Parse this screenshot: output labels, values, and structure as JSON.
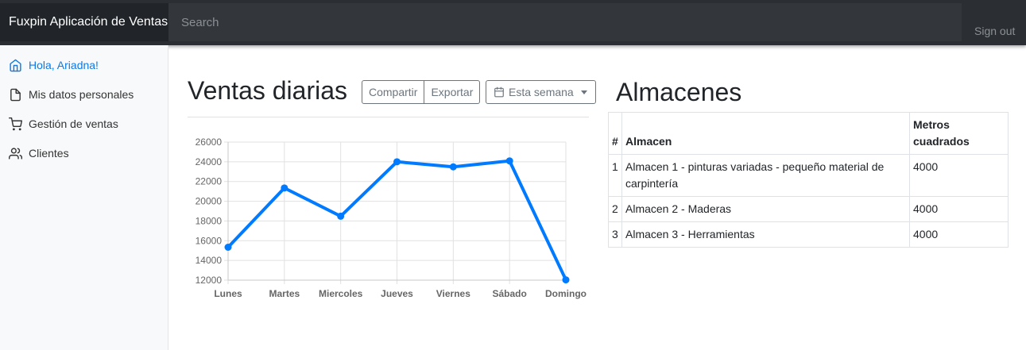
{
  "navbar": {
    "brand": "Fuxpin Aplicación de Ventas",
    "search_placeholder": "Search",
    "signout": "Sign out"
  },
  "sidebar": {
    "items": [
      {
        "label": "Hola, Ariadna!",
        "icon": "home-icon",
        "active": true
      },
      {
        "label": "Mis datos personales",
        "icon": "file-icon",
        "active": false
      },
      {
        "label": "Gestión de ventas",
        "icon": "shopping-cart-icon",
        "active": false
      },
      {
        "label": "Clientes",
        "icon": "users-icon",
        "active": false
      }
    ]
  },
  "sales": {
    "title": "Ventas diarias",
    "share_label": "Compartir",
    "export_label": "Exportar",
    "period_label": "Esta semana"
  },
  "chart_data": {
    "type": "line",
    "categories": [
      "Lunes",
      "Martes",
      "Miercoles",
      "Jueves",
      "Viernes",
      "Sábado",
      "Domingo"
    ],
    "values": [
      15339,
      21345,
      18483,
      24003,
      23489,
      24092,
      12034
    ],
    "ylim": [
      12000,
      26000
    ],
    "yticks": [
      12000,
      14000,
      16000,
      18000,
      20000,
      22000,
      24000,
      26000
    ],
    "grid": true,
    "line_color": "#007bff"
  },
  "warehouses": {
    "title": "Almacenes",
    "headers": [
      "#",
      "Almacen",
      "Metros cuadrados"
    ],
    "rows": [
      [
        "1",
        "Almacen 1 - pinturas variadas - pequeño material de carpintería",
        "4000"
      ],
      [
        "2",
        "Almacen 2 - Maderas",
        "4000"
      ],
      [
        "3",
        "Almacen 3 - Herramientas",
        "4000"
      ]
    ]
  }
}
